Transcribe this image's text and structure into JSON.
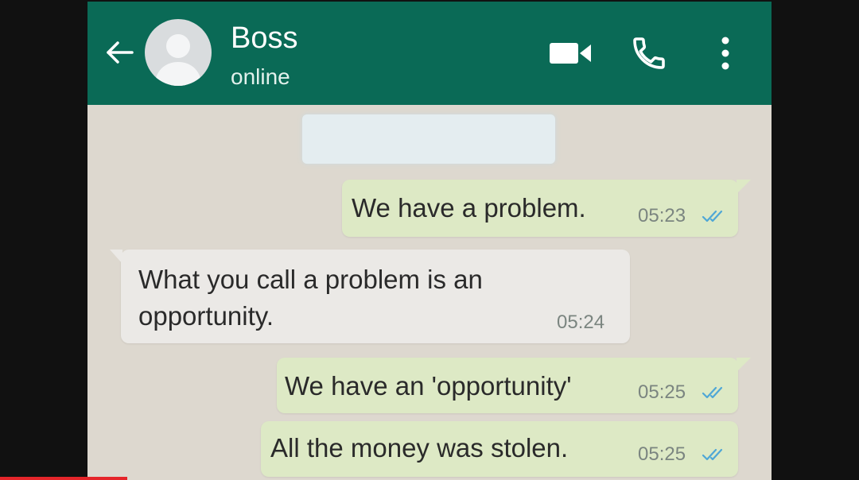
{
  "header": {
    "contact_name": "Boss",
    "status": "online",
    "background_color": "#0a6a56",
    "icons": [
      "back-arrow-icon",
      "avatar",
      "video-call-icon",
      "phone-icon",
      "more-vertical-icon"
    ]
  },
  "messages": [
    {
      "direction": "outgoing",
      "text": "We have a problem.",
      "time": "05:23",
      "read": true
    },
    {
      "direction": "incoming",
      "text_line1": "What you call a problem is an",
      "text_line2": "opportunity.",
      "time": "05:24"
    },
    {
      "direction": "outgoing",
      "text": "We have an 'opportunity'",
      "time": "05:25",
      "read": true
    },
    {
      "direction": "outgoing",
      "text": "All the money was stolen.",
      "time": "05:25",
      "read": true
    }
  ],
  "colors": {
    "outgoing_bubble": "#dde9c5",
    "incoming_bubble": "#ebe9e6",
    "read_ticks": "#4fa7d6"
  }
}
